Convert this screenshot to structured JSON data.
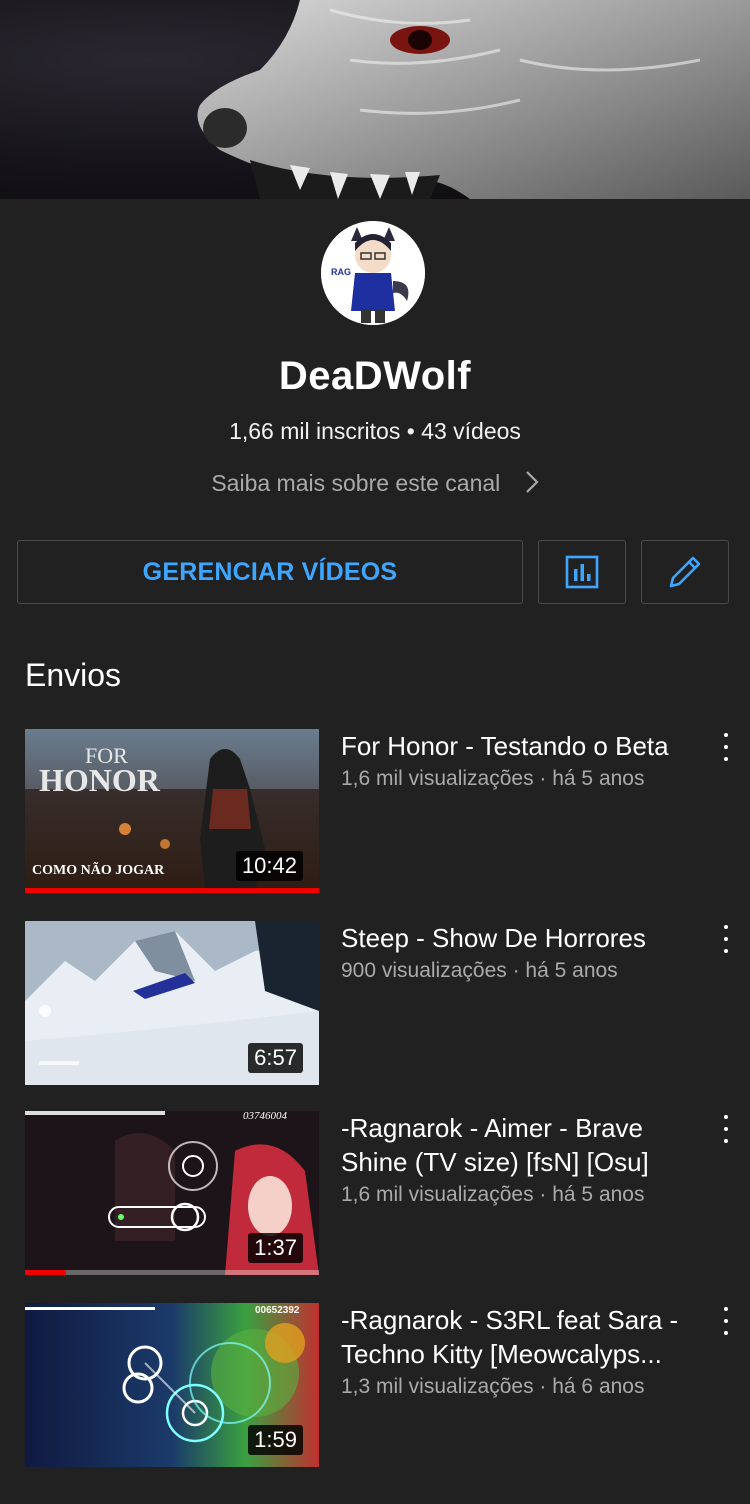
{
  "channel": {
    "name": "DeaDWolf",
    "stats": "1,66 mil inscritos • 43 vídeos",
    "about_link": "Saiba mais sobre este canal",
    "avatar_text": "RAG"
  },
  "actions": {
    "manage_label": "GERENCIAR VÍDEOS",
    "stats_icon": "bar-chart-icon",
    "edit_icon": "pencil-icon"
  },
  "section": {
    "title": "Envios"
  },
  "videos": [
    {
      "title": "For Honor - Testando o Beta",
      "meta": "1,6 mil visualizações · há 5 anos",
      "duration": "10:42",
      "thumb_title": "FOR",
      "thumb_title2": "HONOR",
      "thumb_caption": "COMO NÃO JOGAR",
      "watched_fraction": 1.0
    },
    {
      "title": "Steep - Show De Horrores",
      "meta": "900 visualizações · há 5 anos",
      "duration": "6:57",
      "watched_fraction": 0
    },
    {
      "title": "-Ragnarok - Aimer - Brave Shine (TV size) [fsN] [Osu]",
      "meta": "1,6 mil visualizações · há 5 anos",
      "duration": "1:37",
      "thumb_score": "03746004",
      "watched_fraction": 0.14
    },
    {
      "title": "-Ragnarok - S3RL feat Sara - Techno Kitty [Meowcalyps...",
      "meta": "1,3 mil visualizações · há 6 anos",
      "duration": "1:59",
      "thumb_score": "00652392",
      "watched_fraction": 0
    }
  ],
  "colors": {
    "background": "#212121",
    "accent_blue": "#3ea6ff",
    "secondary_text": "#aaaaaa",
    "progress_red": "#ee0000"
  }
}
